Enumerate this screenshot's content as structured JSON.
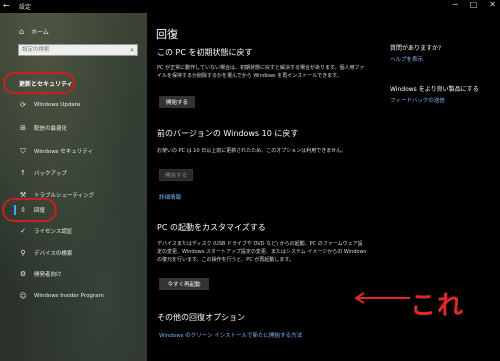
{
  "window": {
    "title": "設定",
    "back_icon": "←",
    "controls": [
      "─",
      "□",
      "✕"
    ]
  },
  "sidebar": {
    "home_label": "ホーム",
    "search_placeholder": "設定の検索",
    "section_title": "更新とセキュリティ",
    "items": [
      {
        "label": "Windows Update",
        "icon": "sync-icon"
      },
      {
        "label": "配信の最適化",
        "icon": "delivery-icon"
      },
      {
        "label": "Windows セキュリティ",
        "icon": "shield-icon"
      },
      {
        "label": "バックアップ",
        "icon": "backup-icon"
      },
      {
        "label": "トラブルシューティング",
        "icon": "wrench-icon"
      },
      {
        "label": "回復",
        "icon": "recovery-icon"
      },
      {
        "label": "ライセンス認証",
        "icon": "check-circle-icon"
      },
      {
        "label": "デバイスの検索",
        "icon": "person-location-icon"
      },
      {
        "label": "開発者向け",
        "icon": "developer-icon"
      },
      {
        "label": "Windows Insider Program",
        "icon": "insider-icon"
      }
    ],
    "active_index": 5
  },
  "main": {
    "title": "回復",
    "reset": {
      "heading": "この PC を初期状態に戻す",
      "description": "PC が正常に動作していない場合は、初期状態に戻すと解決する場合があります。個人用ファイルを保持するか削除するかを選んでから Windows を再インストールできます。",
      "button": "開始する"
    },
    "rollback": {
      "heading": "前のバージョンの Windows 10 に戻す",
      "description": "お使いの PC は 10 日以上前に更新されたため、このオプションは利用できません。",
      "button": "開始する",
      "link": "詳細情報"
    },
    "advanced": {
      "heading": "PC の起動をカスタマイズする",
      "description": "デバイスまたはディスク (USB ドライブや DVD など) からの起動、PC のファームウェア設定の変更、Windows スタートアップ設定の変更、またはシステム イメージからの Windows の復元を行います。この操作を行うと、PC が再起動します。",
      "button": "今すぐ再起動"
    },
    "more": {
      "heading": "その他の回復オプション",
      "link": "Windows のクリーン インストールで新たに開始する方法"
    }
  },
  "right": {
    "question": "質問がありますか?",
    "help_link": "ヘルプを表示",
    "improve": "Windows をより良い製品にする",
    "feedback_link": "フィードバックの送信"
  },
  "annotation": {
    "text": "これ",
    "color": "#e02a2a"
  }
}
